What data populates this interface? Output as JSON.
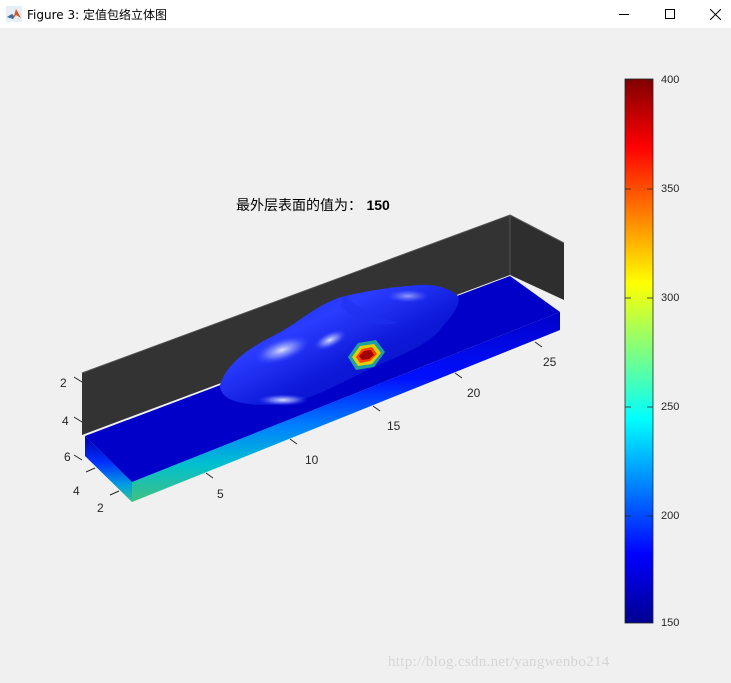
{
  "window": {
    "title": "Figure 3: 定值包络立体图",
    "icon": "matlab-icon",
    "controls": [
      "minimize-icon",
      "maximize-icon",
      "close-icon"
    ]
  },
  "plot": {
    "title_label": "最外层表面的值为：",
    "title_value": "150"
  },
  "axes": {
    "x_ticks": [
      "5",
      "10",
      "15",
      "20",
      "25"
    ],
    "y_ticks": [
      "2",
      "4"
    ],
    "z_ticks": [
      "2",
      "4",
      "6"
    ]
  },
  "colorbar": {
    "colormap": "jet",
    "range": [
      150,
      400
    ],
    "ticks": [
      "400",
      "350",
      "300",
      "250",
      "200",
      "150"
    ]
  },
  "watermark": "http://blog.csdn.net/yangwenbo214"
}
